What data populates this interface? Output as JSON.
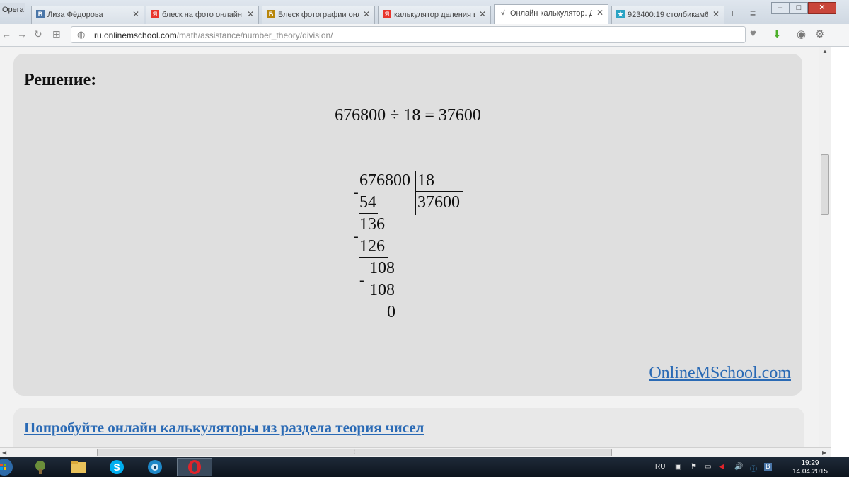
{
  "browser": {
    "menu_label": "Opera",
    "tabs": [
      {
        "title": "Лиза Фёдорова",
        "favicon": "vk-icon",
        "color": "#4a76a8",
        "glyph": "В"
      },
      {
        "title": "блеск на фото онлайн —",
        "favicon": "yandex-icon",
        "color": "#e8342c",
        "glyph": "Я"
      },
      {
        "title": "Блеск фотографии онла",
        "favicon": "site-icon",
        "color": "#b8860b",
        "glyph": "Б"
      },
      {
        "title": "калькулятор деления в",
        "favicon": "yandex-icon",
        "color": "#e8342c",
        "glyph": "Я"
      },
      {
        "title": "Онлайн калькулятор. Де",
        "favicon": "sqrt-icon",
        "color": "#555555",
        "glyph": "√"
      },
      {
        "title": "923400:19 столбикам6",
        "favicon": "site-icon",
        "color": "#2aa3c4",
        "glyph": "★"
      }
    ],
    "url_host": "ru.onlinemschool.com",
    "url_path": "/math/assistance/number_theory/division/"
  },
  "solution": {
    "title": "Решение:",
    "equation": "676800 ÷ 18  = 37600",
    "long_division": {
      "dividend": "676800",
      "divisor": "18",
      "quotient": "37600",
      "steps": [
        "54",
        "136",
        "126",
        "108",
        "108",
        "0"
      ]
    },
    "brand_link": "OnlineMSchool.com"
  },
  "promo": {
    "link_text": "Попробуйте онлайн калькуляторы из раздела теория чисел"
  },
  "taskbar": {
    "lang": "RU",
    "time": "19:29",
    "date": "14.04.2015"
  },
  "colors": {
    "link": "#2a6ab5",
    "panel": "#dfdfdf"
  }
}
